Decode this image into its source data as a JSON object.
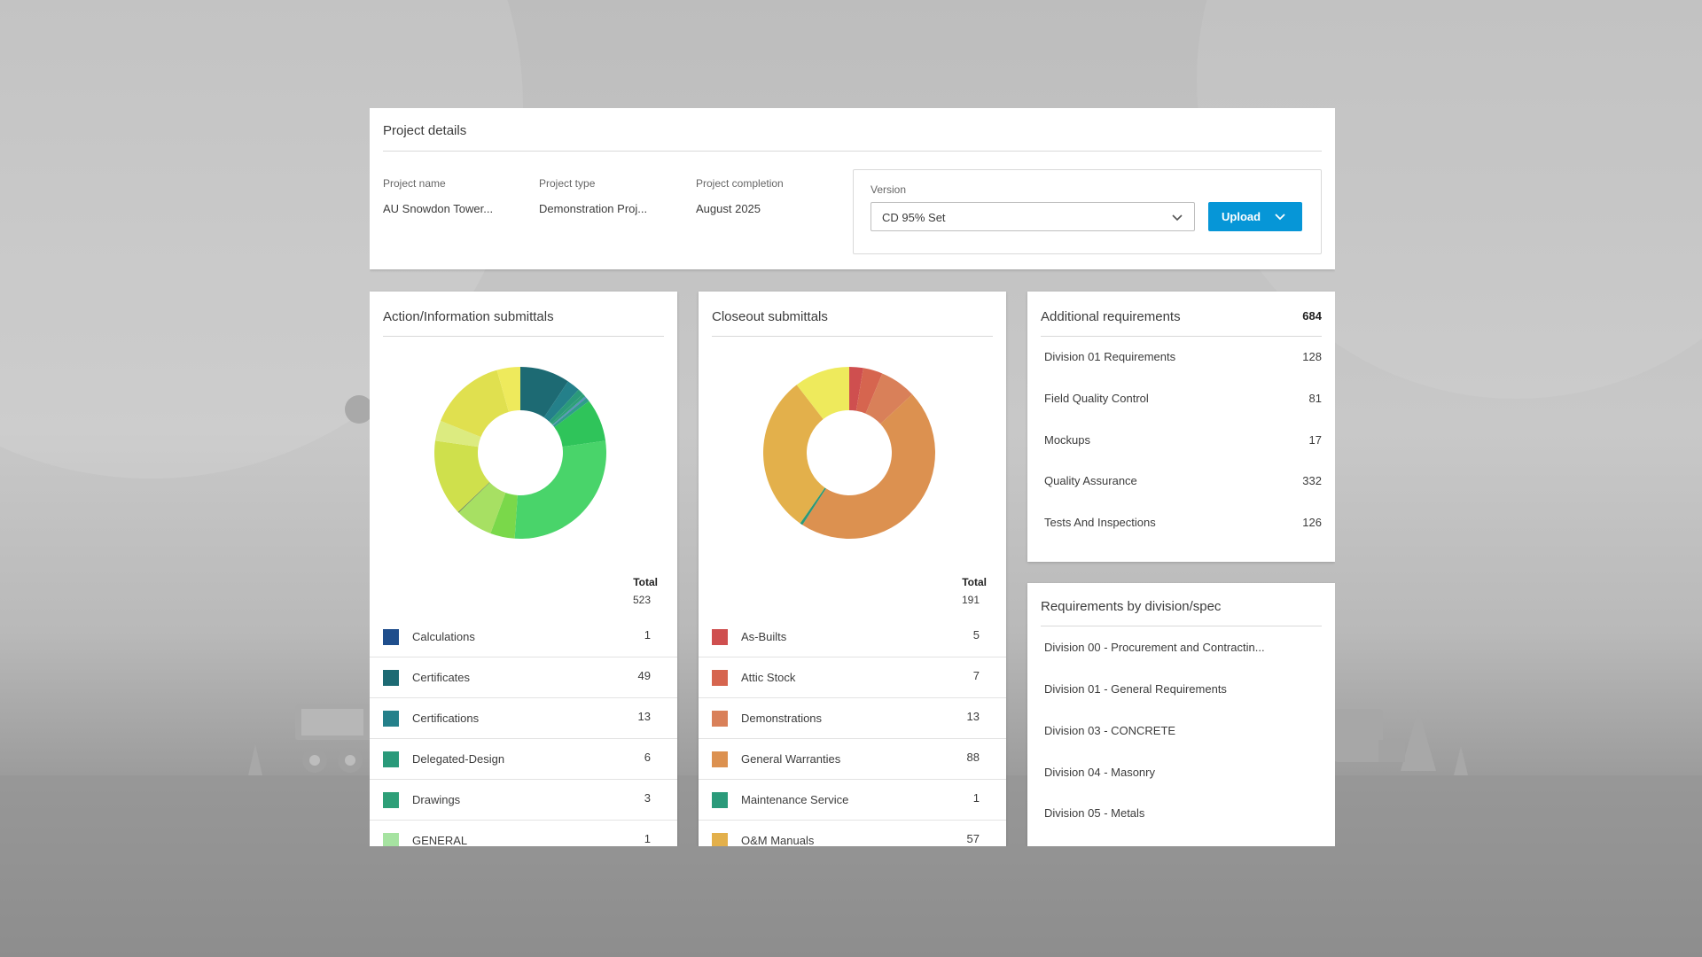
{
  "project": {
    "title": "Project details",
    "fields": [
      {
        "label": "Project name",
        "value": "AU Snowdon Tower..."
      },
      {
        "label": "Project type",
        "value": "Demonstration Proj..."
      },
      {
        "label": "Project completion",
        "value": "August 2025"
      }
    ],
    "version_label": "Version",
    "version_value": "CD 95% Set",
    "upload_label": "Upload"
  },
  "action_submittals": {
    "title": "Action/Information submittals",
    "total_label": "Total",
    "total_value": "523",
    "legend": [
      {
        "label": "Calculations",
        "count": "1",
        "color": "#1f4e8c"
      },
      {
        "label": "Certificates",
        "count": "49",
        "color": "#1d6a73"
      },
      {
        "label": "Certifications",
        "count": "13",
        "color": "#24808a"
      },
      {
        "label": "Delegated-Design",
        "count": "6",
        "color": "#2a9a7a"
      },
      {
        "label": "Drawings",
        "count": "3",
        "color": "#2e9f78"
      },
      {
        "label": "GENERAL",
        "count": "1",
        "color": "#a6e3a1"
      }
    ]
  },
  "closeout_submittals": {
    "title": "Closeout submittals",
    "total_label": "Total",
    "total_value": "191",
    "legend": [
      {
        "label": "As-Builts",
        "count": "5",
        "color": "#cf4f4f"
      },
      {
        "label": "Attic Stock",
        "count": "7",
        "color": "#d6654f"
      },
      {
        "label": "Demonstrations",
        "count": "13",
        "color": "#d98059"
      },
      {
        "label": "General Warranties",
        "count": "88",
        "color": "#dc9150"
      },
      {
        "label": "Maintenance Service",
        "count": "1",
        "color": "#2a9a7a"
      },
      {
        "label": "O&M Manuals",
        "count": "57",
        "color": "#e3b04b"
      }
    ]
  },
  "additional_requirements": {
    "title": "Additional requirements",
    "total": "684",
    "items": [
      {
        "label": "Division 01 Requirements",
        "count": "128"
      },
      {
        "label": "Field Quality Control",
        "count": "81"
      },
      {
        "label": "Mockups",
        "count": "17"
      },
      {
        "label": "Quality Assurance",
        "count": "332"
      },
      {
        "label": "Tests And Inspections",
        "count": "126"
      }
    ]
  },
  "requirements_by_division": {
    "title": "Requirements by division/spec",
    "items": [
      {
        "label": "Division 00 - Procurement and Contractin..."
      },
      {
        "label": "Division 01 - General Requirements"
      },
      {
        "label": "Division 03 - CONCRETE"
      },
      {
        "label": "Division 04 - Masonry"
      },
      {
        "label": "Division 05 - Metals"
      }
    ]
  },
  "chart_data": [
    {
      "type": "pie",
      "title": "Action/Information submittals",
      "donut": true,
      "slices": [
        {
          "value": 49,
          "color": "#1d6a73"
        },
        {
          "value": 13,
          "color": "#24808a"
        },
        {
          "value": 6,
          "color": "#2a9a7a"
        },
        {
          "value": 3,
          "color": "#2e9f78"
        },
        {
          "value": 1,
          "color": "#3f9fa6"
        },
        {
          "value": 1,
          "color": "#5f7dbf"
        },
        {
          "value": 4,
          "color": "#2f9e8a"
        },
        {
          "value": 42,
          "color": "#2fc45a"
        },
        {
          "value": 148,
          "color": "#49d46a"
        },
        {
          "value": 24,
          "color": "#7ad84a"
        },
        {
          "value": 37,
          "color": "#a7e063"
        },
        {
          "value": 1,
          "color": "#6e8c56"
        },
        {
          "value": 75,
          "color": "#cfe04c"
        },
        {
          "value": 20,
          "color": "#dceb80"
        },
        {
          "value": 76,
          "color": "#e0e04f"
        },
        {
          "value": 23,
          "color": "#eeea5c"
        }
      ]
    },
    {
      "type": "pie",
      "title": "Closeout submittals",
      "donut": true,
      "slices": [
        {
          "value": 5,
          "color": "#cf4f4f"
        },
        {
          "value": 7,
          "color": "#d6654f"
        },
        {
          "value": 13,
          "color": "#d98059"
        },
        {
          "value": 88,
          "color": "#dc9150"
        },
        {
          "value": 1,
          "color": "#2a9a7a"
        },
        {
          "value": 57,
          "color": "#e3b04b"
        },
        {
          "value": 20,
          "color": "#eeea5c"
        }
      ]
    }
  ]
}
